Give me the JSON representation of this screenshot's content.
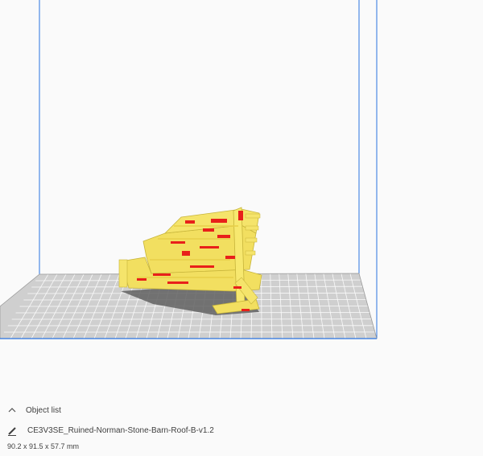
{
  "object_panel": {
    "object_list_label": "Object list",
    "object_name": "CE3V3SE_Ruined-Norman-Stone-Barn-Roof-B-v1.2",
    "dimensions": "90.2 x 91.5 x 57.7 mm"
  },
  "icons": {
    "object_list_toggle": "chevron-up-icon",
    "edit_name": "pencil-icon"
  },
  "colors": {
    "build_volume_outline": "#2b74e0",
    "build_plate": "#c9c9c9",
    "model_fill": "#f2df60",
    "model_overhang": "#e8201a",
    "background": "#fafafa"
  }
}
